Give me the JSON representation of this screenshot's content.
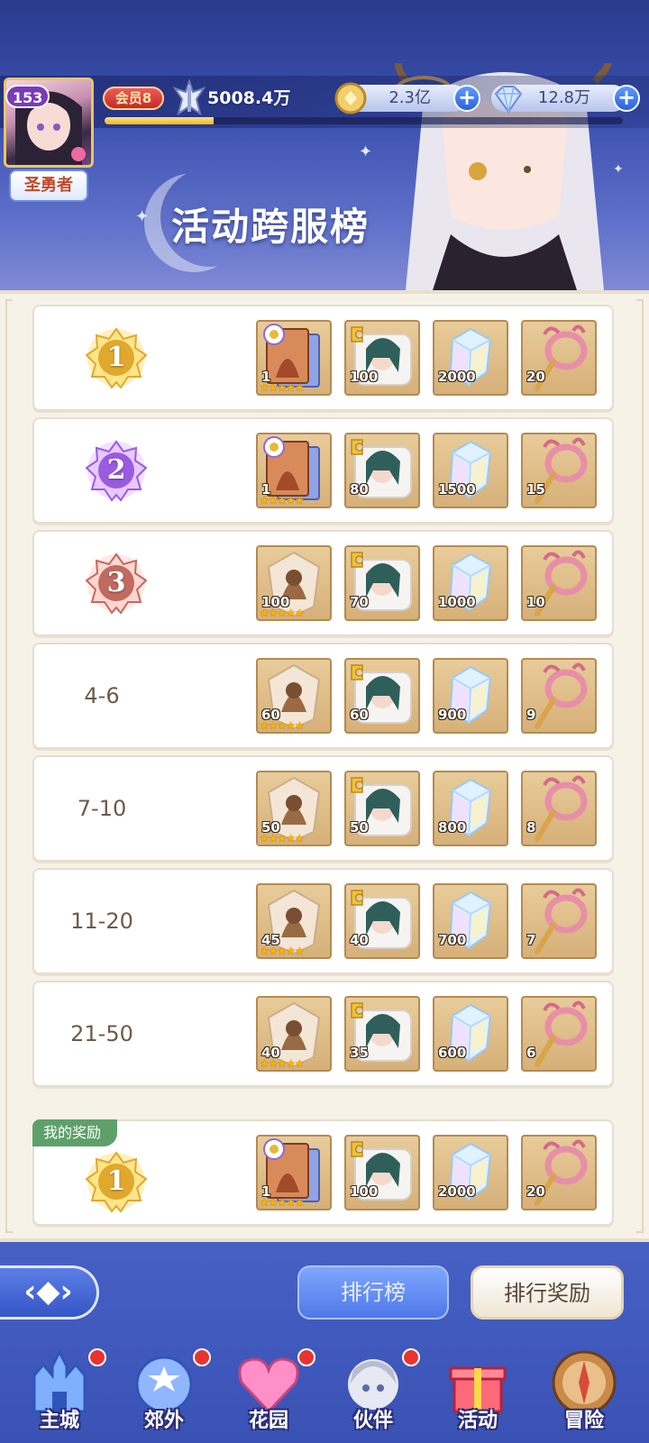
{
  "header": {
    "player_level": "153",
    "title_badge": "圣勇者",
    "vip": "会员8",
    "power": "5008.4万",
    "exp_fraction": 0.21,
    "gold": "2.3亿",
    "diamonds": "12.8万",
    "page_title": "活动跨服榜"
  },
  "ranks": [
    {
      "rank": "1",
      "medal": "gold",
      "items": [
        {
          "type": "hero-card",
          "qty": "1",
          "stars": "★★★★★"
        },
        {
          "type": "pillow-puzzle",
          "qty": "100"
        },
        {
          "type": "crystal",
          "qty": "2000"
        },
        {
          "type": "staff",
          "qty": "20"
        }
      ]
    },
    {
      "rank": "2",
      "medal": "purple",
      "items": [
        {
          "type": "hero-card",
          "qty": "1",
          "stars": "★★★★★"
        },
        {
          "type": "pillow-puzzle",
          "qty": "80"
        },
        {
          "type": "crystal",
          "qty": "1500"
        },
        {
          "type": "staff",
          "qty": "15"
        }
      ]
    },
    {
      "rank": "3",
      "medal": "bronze",
      "items": [
        {
          "type": "hero-shard",
          "qty": "100",
          "stars": "★★★★★"
        },
        {
          "type": "pillow-puzzle",
          "qty": "70"
        },
        {
          "type": "crystal",
          "qty": "1000"
        },
        {
          "type": "staff",
          "qty": "10"
        }
      ]
    },
    {
      "rank": "4-6",
      "medal": "",
      "items": [
        {
          "type": "hero-shard",
          "qty": "60",
          "stars": "★★★★★"
        },
        {
          "type": "pillow-puzzle",
          "qty": "60"
        },
        {
          "type": "crystal",
          "qty": "900"
        },
        {
          "type": "staff",
          "qty": "9"
        }
      ]
    },
    {
      "rank": "7-10",
      "medal": "",
      "items": [
        {
          "type": "hero-shard",
          "qty": "50",
          "stars": "★★★★★"
        },
        {
          "type": "pillow-puzzle",
          "qty": "50"
        },
        {
          "type": "crystal",
          "qty": "800"
        },
        {
          "type": "staff",
          "qty": "8"
        }
      ]
    },
    {
      "rank": "11-20",
      "medal": "",
      "items": [
        {
          "type": "hero-shard",
          "qty": "45",
          "stars": "★★★★★"
        },
        {
          "type": "pillow-puzzle",
          "qty": "40"
        },
        {
          "type": "crystal",
          "qty": "700"
        },
        {
          "type": "staff",
          "qty": "7"
        }
      ]
    },
    {
      "rank": "21-50",
      "medal": "",
      "items": [
        {
          "type": "hero-shard",
          "qty": "40",
          "stars": "★★★★★"
        },
        {
          "type": "pillow-puzzle",
          "qty": "35"
        },
        {
          "type": "crystal",
          "qty": "600"
        },
        {
          "type": "staff",
          "qty": "6"
        }
      ]
    }
  ],
  "my_reward": {
    "label": "我的奖励",
    "rank": "1",
    "medal": "gold",
    "items": [
      {
        "type": "hero-card",
        "qty": "1",
        "stars": "★★★★★"
      },
      {
        "type": "pillow-puzzle",
        "qty": "100"
      },
      {
        "type": "crystal",
        "qty": "2000"
      },
      {
        "type": "staff",
        "qty": "20"
      }
    ]
  },
  "tabs": {
    "ranking": "排行榜",
    "ranking_reward": "排行奖励"
  },
  "nav": [
    {
      "label": "主城",
      "icon": "castle-icon",
      "dot": true
    },
    {
      "label": "郊外",
      "icon": "portal-icon",
      "dot": true
    },
    {
      "label": "花园",
      "icon": "heart-icon",
      "dot": true
    },
    {
      "label": "伙伴",
      "icon": "partner-icon",
      "dot": true
    },
    {
      "label": "活动",
      "icon": "gift-icon",
      "dot": false
    },
    {
      "label": "冒险",
      "icon": "compass-icon",
      "dot": false
    }
  ],
  "colors": {
    "accent": "#3b4fae",
    "panel": "#f7f2e8",
    "item_bg": "#d6b079"
  }
}
